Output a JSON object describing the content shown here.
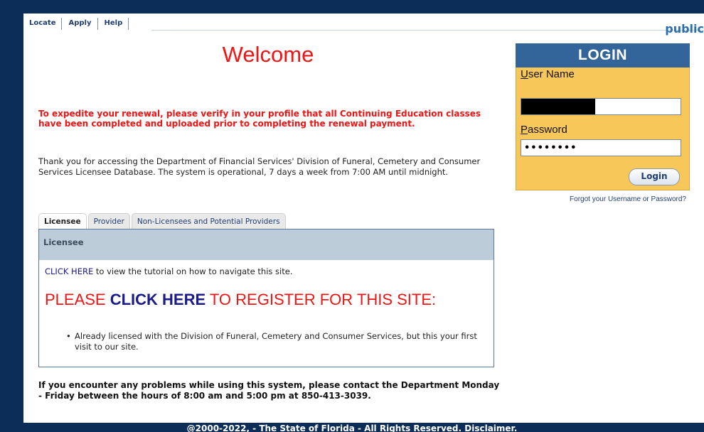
{
  "nav": {
    "items": [
      "Locate",
      "Apply",
      "Help"
    ]
  },
  "header": {
    "user_text": "public"
  },
  "main": {
    "welcome_title": "Welcome",
    "notice": "To expedite your renewal, please verify in your profile that all Continuing Education classes have been completed and uploaded prior to completing the renewal payment.",
    "intro": "Thank you for accessing the Department of Financial Services' Division of Funeral, Cemetery and Consumer Services Licensee Database. The system is operational, 7 days a week from 7:00 AM until midnight.",
    "tabs": [
      {
        "label": "Licensee",
        "active": true
      },
      {
        "label": "Provider",
        "active": false
      },
      {
        "label": "Non-Licensees and Potential Providers",
        "active": false
      }
    ],
    "panel": {
      "heading": "Licensee",
      "tutorial_link": "CLICK HERE",
      "tutorial_text": " to view the tutorial on how to navigate this site.",
      "register_prefix": "PLEASE ",
      "register_link": "CLICK HERE",
      "register_suffix": " TO REGISTER FOR THIS SITE:",
      "bullets": [
        "Already licensed with the Division of Funeral, Cemetery and Consumer Services, but this your first visit to our site."
      ]
    },
    "contact": "If you encounter any problems while using this system, please contact the Department Monday - Friday between the hours of 8:00 am and 5:00 pm at 850-413-3039."
  },
  "login": {
    "title": "LOGIN",
    "username_label_u": "U",
    "username_label_rest": "ser Name",
    "password_label_u": "P",
    "password_label_rest": "assword",
    "password_value": "••••••••",
    "button": "Login",
    "forgot": "Forgot your Username or Password?"
  },
  "footer": {
    "text": "@2000-2022, - The State of Florida - All Rights Reserved. Disclaimer."
  },
  "colors": {
    "frame": "#0b2d57",
    "alert_red": "#f01414",
    "login_header": "#33649a",
    "login_body": "#f8c75a",
    "panel_header": "#bcccd9"
  }
}
